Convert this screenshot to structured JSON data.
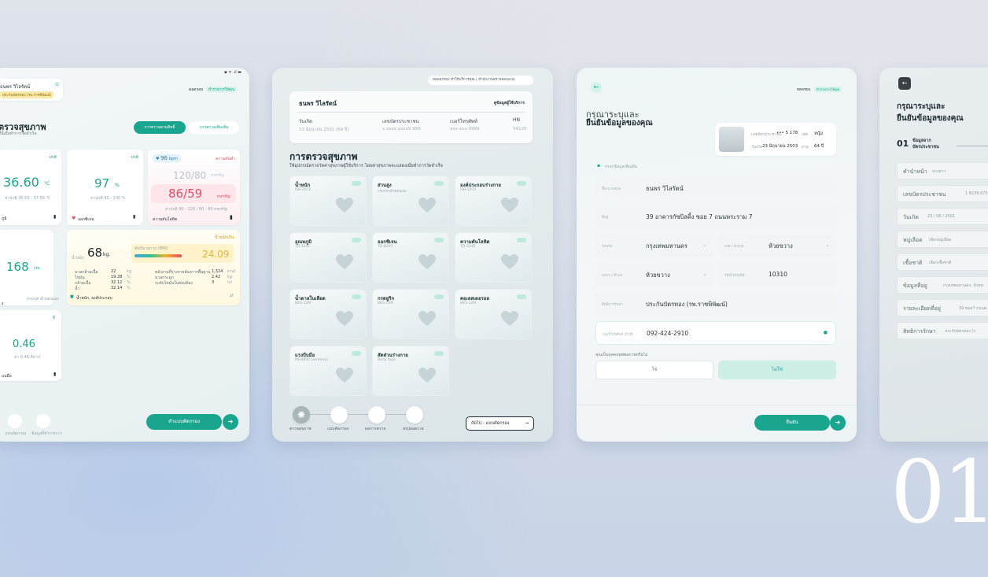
{
  "status_bar": {
    "icons": "▪ ᯤ .ıl ▬"
  },
  "screen1": {
    "user_name": "ธนพร วิไลรัตน์",
    "user_badge": "ประกันบัตรทอง (รพ.ราชพิพัฒน์)",
    "staff": "ดอดรอบ",
    "staff_tag": "ทำรายการให้คุณ",
    "title": "ตรวจสุขภาพ",
    "subtitle": "ที่นี่เมื่อทำการวัดสำเร็จ",
    "tabs": [
      "การตรวจตามสิทธิ์",
      "การตรวจเพิ่มเติม"
    ],
    "temp": {
      "status": "ปกติ",
      "value": "36.60",
      "unit": "°C",
      "range": "ค่าปกติ 36.50 - 37.50 °C",
      "label": "ภูมิ"
    },
    "spo2": {
      "status": "ปกติ",
      "value": "97",
      "unit": "%",
      "range": "ค่าปกติ 95 - 100 %",
      "label": "ออกซิเจน"
    },
    "bp": {
      "bpm": "96",
      "bpm_unit": "bpm",
      "status": "ความดันต่ำ",
      "sys": "120/80",
      "sys_unit": "mmHg",
      "dia": "86/59",
      "dia_unit": "mmHg",
      "range": "ค่าปกติ 90 - 120 / 60 - 80 mmHg",
      "label": "ความดันโลหิต"
    },
    "height": {
      "value": "168",
      "unit": "cm.",
      "label": "ง",
      "sub": "กรอกค่าด้วยตนเอง"
    },
    "weight": {
      "tag": "น้ำหนักเกิน",
      "label_w": "น้ำหนัก",
      "value": "68",
      "unit": "kg.",
      "bmi_label": "ดัชนีมวลกาย (BMI)",
      "bmi": "24.09",
      "rows_left": [
        [
          "มวลกล้ามเนื้อ",
          "22",
          "kg"
        ],
        [
          "ไขมัน",
          "19.28",
          "%"
        ],
        [
          "กล้ามเนื้อ",
          "32.12",
          "%"
        ],
        [
          "น้ำ",
          "32.14",
          "%"
        ]
      ],
      "rows_right": [
        [
          "พลังงานที่ร่างกายต้องการพื้นฐาน",
          "1,324",
          "kcal"
        ],
        [
          "มวลกระดูก",
          "2.42",
          "kg"
        ],
        [
          "ระดับไขมันในช่องท้อง",
          "3",
          "lvl"
        ]
      ],
      "footer": "น้ำหนัก, องค์ประกอบ"
    },
    "grip": {
      "status": "ดี",
      "value": "0.46",
      "sub": "ค่า 0.46 ดีมาก",
      "label": "แบมือ"
    },
    "bottom": [
      "แบบคัดกรอง",
      "ข้อมูลที่ทำรายการ"
    ],
    "cta": "ทำแบบคัดกรอง"
  },
  "screen2": {
    "top_pill": "ทดลองรอบ ทำให้บริการคุณ | สำนักงานตรวจสอบแบบ",
    "name": "ธนพร วิไลรัตน์",
    "link": "ดูข้อมูลผู้ใช้บริการ",
    "cols": [
      {
        "label": "วันเกิด",
        "value": "23 มิถุนายน 2501 (64 ปี)"
      },
      {
        "label": "เลขบัตรประชาชน",
        "value": "x xxxx xxxx9 999"
      },
      {
        "label": "เบอร์โทรศัพท์",
        "value": "xxx-xxx-9999"
      },
      {
        "label": "HN",
        "value": "54120"
      }
    ],
    "title": "การตรวจสุขภาพ",
    "subtitle": "ใช้อุปกรณ์ตรวจวัดค่าสุขภาพผู้ใช้บริการ โดยค่าสุขภาพจะแสดงเมื่อทำการวัดสำเร็จ",
    "tests": [
      [
        "น้ำหนัก",
        "ISB-2072"
      ],
      [
        "ส่วนสูง",
        "กรอกค่าด้วยตนเอง"
      ],
      [
        "องค์ประกอบร่างกาย",
        "ISB-2072"
      ],
      [
        "อุณหภูมิ",
        "TD-1241"
      ],
      [
        "ออกซิเจน",
        "TD-8255"
      ],
      [
        "ความดันโลหิต",
        "TD-3140"
      ],
      [
        "น้ำตาลในเลือด",
        "BKS-12M"
      ],
      [
        "กรดยูริก",
        "BKS-12M"
      ],
      [
        "คอเลสเตอรอล",
        "BKS-12M"
      ],
      [
        "แรงบีบมือ",
        "MG4800 (wireless)"
      ],
      [
        "สัดส่วนร่างกาย",
        "Body tape"
      ]
    ],
    "steps": [
      "ตรวจสุขภาพ",
      "แบบคัดกรอง",
      "ผลการตรวจ",
      "สรุปผลตรวจ"
    ],
    "next": "ถัดไป : แบบคัดกรอง"
  },
  "screen3": {
    "staff": "ทดพรธน",
    "staff_tag": "ทำรายการให้คุณ",
    "title1": "กรุณาระบุและ",
    "title2": "ยืนยันข้อมูลของคุณ",
    "id_label": "เลขบัตรประชาชน",
    "id_value": "•••  5 178",
    "sex_label": "เพศ",
    "sex": "หญิง",
    "dob_label": "วันเกิด",
    "dob": "23 มิถุนายน 2503",
    "age_label": "อายุ",
    "age": "64 ปี",
    "section": "กรอกข้อมูลเพิ่มเติม",
    "fields": [
      [
        "ชื่อ-นามสกุล",
        "ธนพร วิไลรัตน์"
      ],
      [
        "ที่อยู่",
        "39 อาคารกัซบิลดิ้ง ซอย 7 ถนนพระราม 7"
      ]
    ],
    "province": [
      "จังหวัด",
      "กรุงเทพมหานคร"
    ],
    "district": [
      "เขต / อำเภอ",
      "ห้วยขวาง"
    ],
    "subdistrict": [
      "แขวง / ตำบล",
      "ห้วยขวาง"
    ],
    "postcode": [
      "รหัสไปรษณีย์",
      "10310"
    ],
    "right": [
      "สิทธิการรักษา",
      "ประกันบัตรทอง (รพ.ราชพิพัฒน์)"
    ],
    "phone": [
      "เบอร์โทรศัพท์ (ถ้ามี)",
      "092-424-2910"
    ],
    "question": "คุณเป็นบุคคลทุพพลภาพหรือไม่",
    "yes": "ใช่",
    "no": "ไม่ใช่",
    "confirm": "ยืนยัน"
  },
  "screen4": {
    "title1": "กรุณาระบุและ",
    "title2": "ยืนยันข้อมูลของคุณ",
    "step_no": "01",
    "step_label1": "ข้อมูลจาก",
    "step_label2": "บัตรประชาชน",
    "rows": [
      [
        "คำนำหน้า",
        "นางสาว"
      ],
      [
        "เลขบัตรประชาชน",
        "1 8239 67355"
      ],
      [
        "วันเกิด",
        "23 / 06 / 2501"
      ],
      [
        "หมู่เลือด",
        "เลือกหมู่เลือด"
      ],
      [
        "เชื้อชาติ",
        "เลือกเชื้อชาติ"
      ],
      [
        "ข้อมูลที่อยู่",
        "กรุงเทพมหานคร, ห้วยข"
      ],
      [
        "รายละเอียดที่อยู่",
        "39 ซอย7 ถนนพ"
      ],
      [
        "สิทธิการรักษา",
        "ประกันบัตรทอง (ร"
      ]
    ]
  },
  "big_number": "01",
  "colors": {
    "accent": "#1aa58f",
    "danger": "#e0506a",
    "warning": "#f2b230"
  }
}
